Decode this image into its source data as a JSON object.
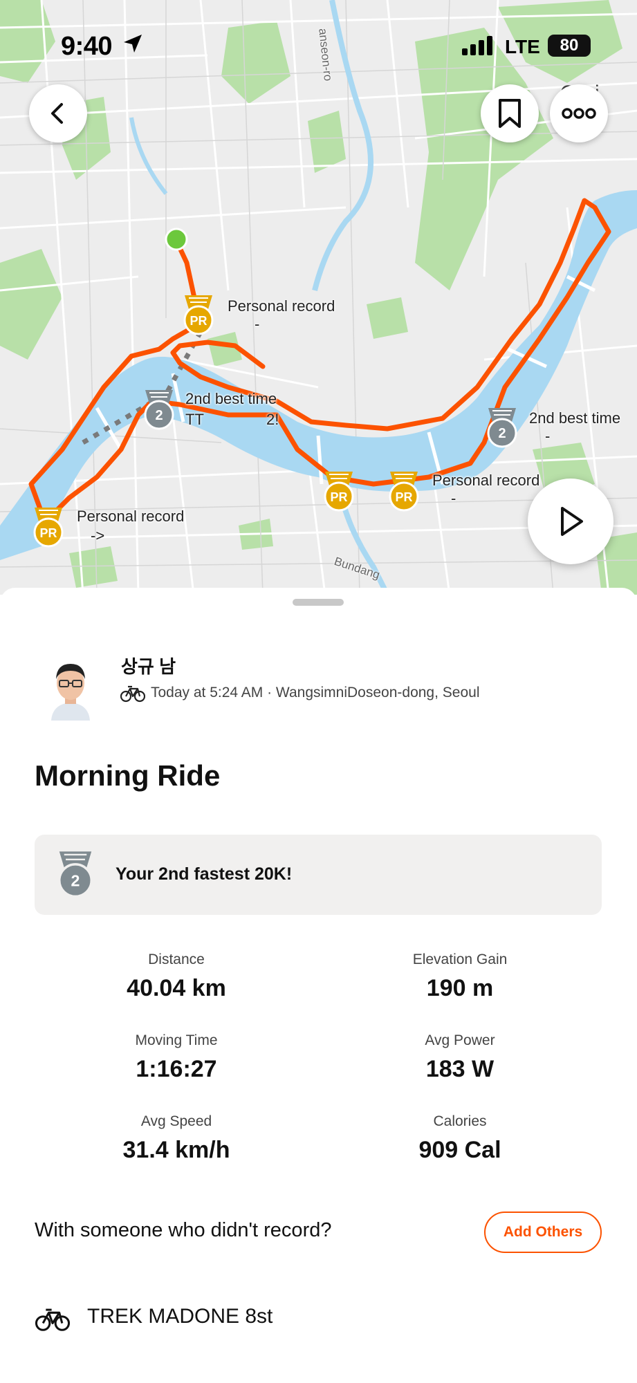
{
  "status_bar": {
    "time": "9:40",
    "network": "LTE",
    "battery": "80"
  },
  "map": {
    "road_labels": [
      "anseon-ro",
      "Bundang",
      "Guri"
    ],
    "markers": [
      {
        "type": "PR",
        "label": "Personal record",
        "sub": "-"
      },
      {
        "type": "2nd",
        "label": "2nd best time",
        "sub": "TT",
        "sub2": "2!"
      },
      {
        "type": "2nd",
        "label": "2nd best time",
        "sub": "-"
      },
      {
        "type": "PR",
        "label": "Personal record",
        "sub": "-"
      },
      {
        "type": "PR",
        "label": "Personal record",
        "sub": "->"
      }
    ],
    "medal_text_pr": "PR",
    "medal_text_second": "2",
    "colors": {
      "route": "#fc5200",
      "water": "#a9d8f2",
      "park": "#b6e0a6",
      "land": "#eeeeee",
      "start": "#6cc83c"
    }
  },
  "activity": {
    "athlete_name": "상규 남",
    "meta": "Today at 5:24 AM · WangsimniDoseon-dong, Seoul",
    "title": "Morning Ride",
    "achievement": "Your 2nd fastest 20K!",
    "stats": [
      {
        "label": "Distance",
        "value": "40.04 km"
      },
      {
        "label": "Elevation Gain",
        "value": "190 m"
      },
      {
        "label": "Moving Time",
        "value": "1:16:27"
      },
      {
        "label": "Avg Power",
        "value": "183 W"
      },
      {
        "label": "Avg Speed",
        "value": "31.4 km/h"
      },
      {
        "label": "Calories",
        "value": "909 Cal"
      }
    ],
    "with_someone": "With someone who didn't record?",
    "add_others": "Add Others",
    "gear": "TREK MADONE 8st"
  },
  "icons": {
    "back": "chevron-left-icon",
    "bookmark": "bookmark-icon",
    "more": "more-horizontal-icon",
    "play": "play-icon",
    "bike": "bike-icon"
  },
  "accent_color": "#fc5200"
}
